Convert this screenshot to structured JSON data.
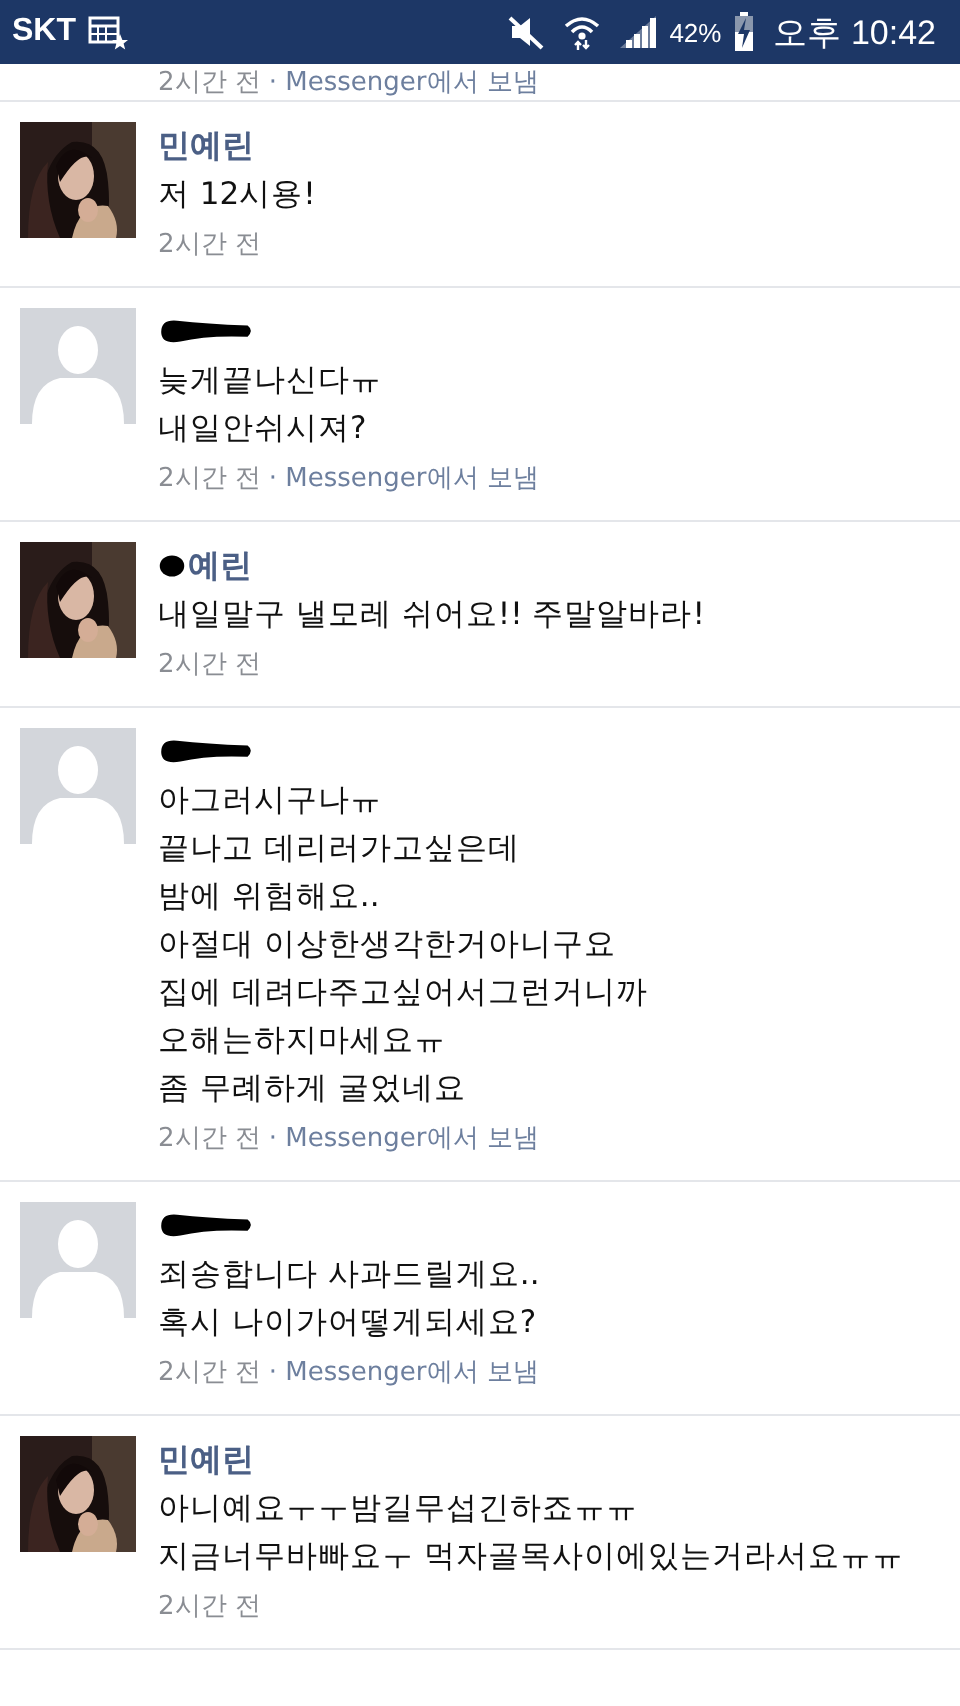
{
  "status_bar": {
    "carrier": "SKT",
    "battery_percent": "42%",
    "time": "오후 10:42"
  },
  "top_partial": {
    "time": "2시간 전",
    "via": "· Messenger에서 보냄"
  },
  "messages": [
    {
      "avatar": {
        "kind": "picture"
      },
      "name_mark": {
        "kind": "none"
      },
      "name": "민예린",
      "lines": [
        "저 12시용!"
      ],
      "time": "2시간 전"
    },
    {
      "avatar": {
        "kind": "default"
      },
      "name_mark": {
        "kind": "full"
      },
      "lines": [
        "늦게끝나신다ㅠ",
        "내일안쉬시져?"
      ],
      "time": "2시간 전",
      "via": "· Messenger에서 보냄"
    },
    {
      "avatar": {
        "kind": "picture"
      },
      "name_mark": {
        "kind": "partial"
      },
      "name": "예린",
      "lines": [
        "내일말구 낼모레 쉬어요!! 주말알바라!"
      ],
      "time": "2시간 전"
    },
    {
      "avatar": {
        "kind": "default"
      },
      "name_mark": {
        "kind": "full"
      },
      "lines": [
        "아그러시구나ㅠ",
        "끝나고 데리러가고싶은데",
        "밤에 위험해요..",
        "아절대 이상한생각한거아니구요",
        "집에 데려다주고싶어서그런거니까",
        "오해는하지마세요ㅠ",
        "좀 무례하게 굴었네요"
      ],
      "time": "2시간 전",
      "via": "· Messenger에서 보냄"
    },
    {
      "avatar": {
        "kind": "default"
      },
      "name_mark": {
        "kind": "full"
      },
      "lines": [
        "죄송합니다 사과드릴게요..",
        "혹시 나이가어떻게되세요?"
      ],
      "time": "2시간 전",
      "via": "· Messenger에서 보냄"
    },
    {
      "avatar": {
        "kind": "picture"
      },
      "name_mark": {
        "kind": "none"
      },
      "name": "민예린",
      "lines": [
        "아니예요ㅜㅜ밤길무섭긴하죠ㅠㅠ",
        "지금너무바빠요ㅜ 먹자골목사이에있는거라서요ㅠㅠ"
      ],
      "time": "2시간 전"
    }
  ]
}
